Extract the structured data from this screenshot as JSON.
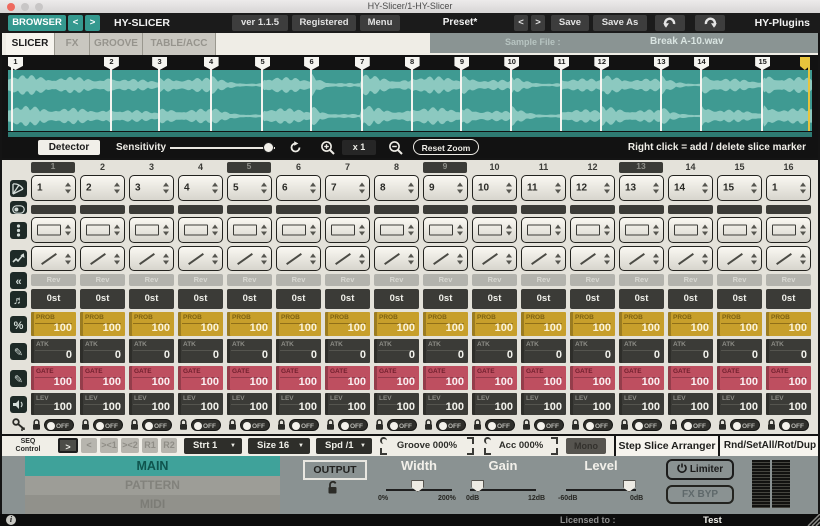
{
  "window": {
    "title": "HY-Slicer/1-HY-Slicer"
  },
  "toolbar": {
    "browser": "BROWSER",
    "prev": "<",
    "next": ">",
    "app_title": "HY-SLICER",
    "version": "ver 1.1.5",
    "registered": "Registered",
    "menu": "Menu",
    "preset": "Preset*",
    "preset_prev": "<",
    "preset_next": ">",
    "save": "Save",
    "save_as": "Save As",
    "brand": "HY-Plugins"
  },
  "tabs": {
    "items": [
      "SLICER",
      "FX",
      "GROOVE",
      "TABLE/ACC"
    ],
    "active": "SLICER",
    "sample_file_label": "Sample File :",
    "sample_file": "Break A-10.wav"
  },
  "waveform": {
    "slice_positions": [
      0.005,
      0.128,
      0.188,
      0.252,
      0.316,
      0.377,
      0.44,
      0.502,
      0.564,
      0.626,
      0.688,
      0.738,
      0.812,
      0.862,
      0.938
    ],
    "end_position": 0.996,
    "bg_color": "#3F9A92",
    "wave_color": "#8CC9C0",
    "end_marker_color": "#E8C43C",
    "hint": "Right click = add / delete slice marker"
  },
  "detector": {
    "button": "Detector",
    "sensitivity_label": "Sensitivity",
    "sensitivity_pos": 0.93,
    "zoom_value": "x 1",
    "reset_zoom": "Reset Zoom"
  },
  "grid": {
    "columns": [
      "1",
      "2",
      "3",
      "4",
      "5",
      "6",
      "7",
      "8",
      "9",
      "10",
      "11",
      "12",
      "13",
      "14",
      "15",
      "16"
    ],
    "beat_columns": [
      1,
      5,
      9,
      13
    ],
    "slice_values": [
      "1",
      "2",
      "3",
      "4",
      "5",
      "6",
      "7",
      "8",
      "9",
      "10",
      "11",
      "12",
      "13",
      "14",
      "15",
      "1"
    ],
    "rev_label": "Rev",
    "pitch_value": "0st",
    "prob_label": "PROB",
    "prob_values": [
      100,
      100,
      100,
      100,
      100,
      100,
      100,
      100,
      100,
      100,
      100,
      100,
      100,
      100,
      100,
      100
    ],
    "atk_label": "ATK",
    "atk_values": [
      0,
      0,
      0,
      0,
      0,
      0,
      0,
      0,
      0,
      0,
      0,
      0,
      0,
      0,
      0,
      0
    ],
    "gate_label": "GATE",
    "gate_values": [
      100,
      100,
      100,
      100,
      100,
      100,
      100,
      100,
      100,
      100,
      100,
      100,
      100,
      100,
      100,
      100
    ],
    "lev_label": "LEV",
    "lev_values": [
      100,
      100,
      100,
      100,
      100,
      100,
      100,
      100,
      100,
      100,
      100,
      100,
      100,
      100,
      100,
      100
    ],
    "toggle_label": "OFF"
  },
  "seq": {
    "label_line1": "SEQ",
    "label_line2": "Control",
    "dir_buttons": [
      ">",
      "<",
      "><1",
      "><2",
      "R1",
      "R2"
    ],
    "active_dir": ">",
    "start": "Strt 1",
    "size": "Size 16",
    "speed": "Spd /1",
    "groove": "Groove 000%",
    "acc": "Acc 000%",
    "mono": "Mono",
    "arranger": "Step Slice Arranger",
    "rnd": "Rnd/SetAll/Rot/Dup"
  },
  "bottom": {
    "tabs": [
      "MAIN",
      "PATTERN",
      "MIDI"
    ],
    "active_tab": "MAIN",
    "output_label": "OUTPUT",
    "sliders": [
      {
        "label": "Width",
        "min": "0%",
        "max": "200%",
        "pos": 0.48
      },
      {
        "label": "Gain",
        "min": "0dB",
        "max": "12dB",
        "pos": 0.12
      },
      {
        "label": "Level",
        "min": "-60dB",
        "max": "0dB",
        "pos": 0.9
      }
    ],
    "limiter": "Limiter",
    "fx_byp": "FX BYP"
  },
  "status": {
    "licensed_label": "Licensed to :",
    "licensed_to": "Test"
  },
  "colors": {
    "accent_teal": "#35998F",
    "prob_gold": "#C79F2B",
    "gate_red": "#BE4F60",
    "panel_grey": "#8A9292"
  }
}
